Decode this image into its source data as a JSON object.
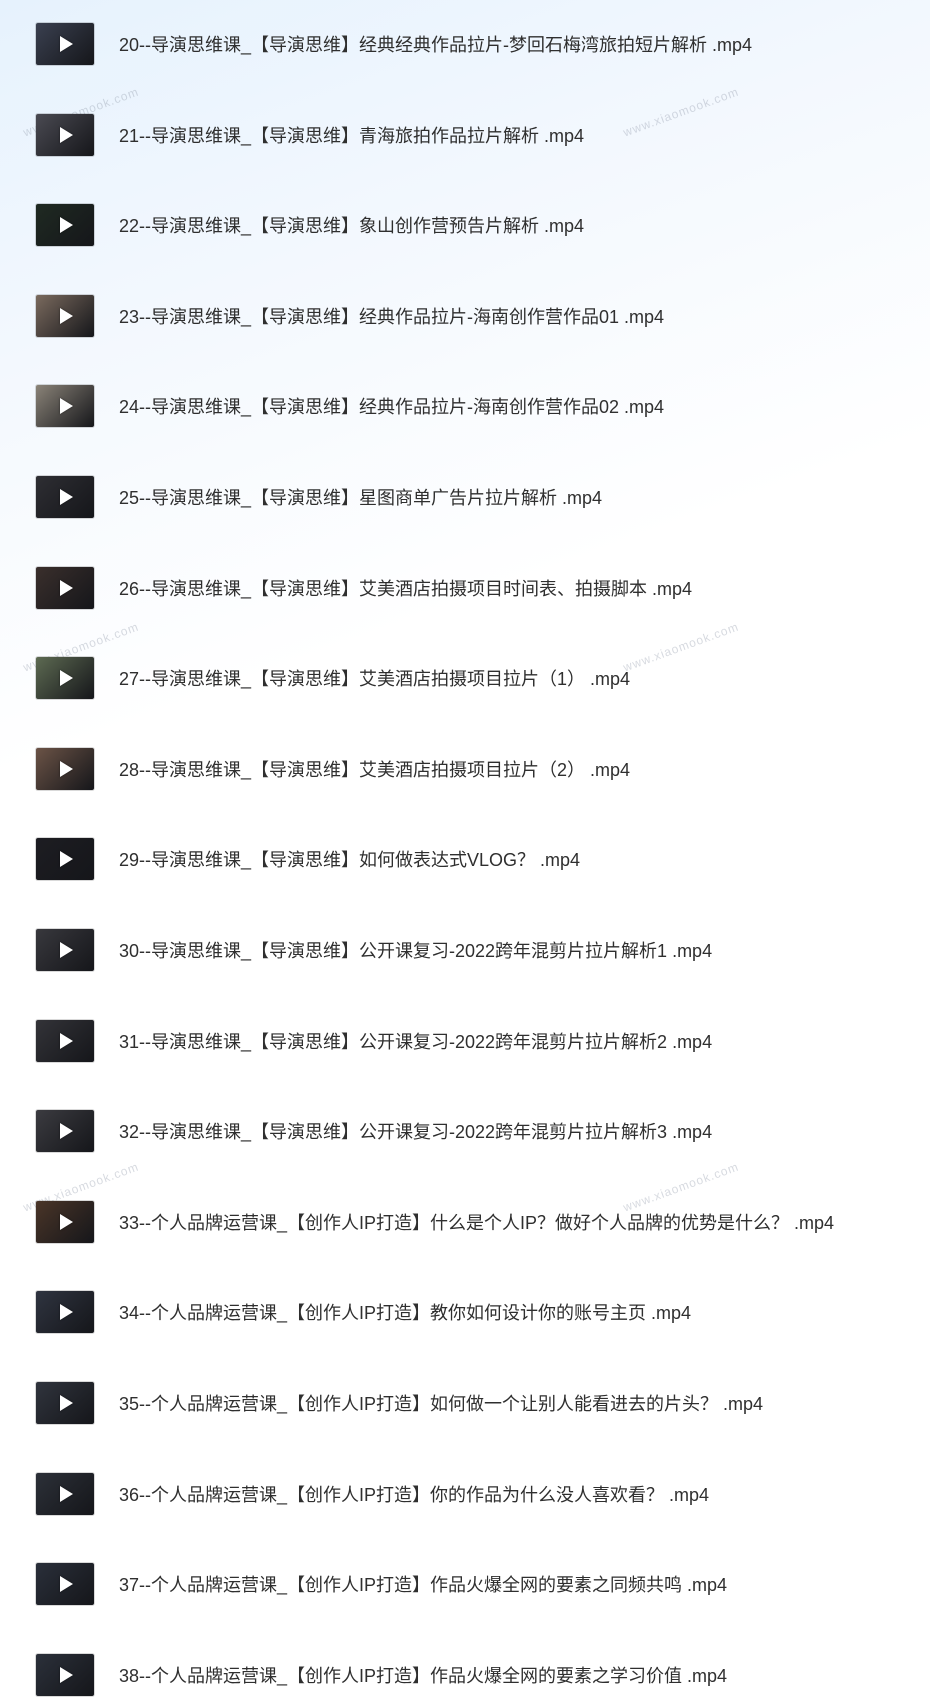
{
  "watermark_text": "www.xiaomook.com",
  "files": [
    {
      "name": "20--导演思维课_【导演思维】经典经典作品拉片-梦回石梅湾旅拍短片解析 .mp4",
      "icon": "video-thumbnail-icon",
      "tone": "#3a4050"
    },
    {
      "name": "21--导演思维课_【导演思维】青海旅拍作品拉片解析 .mp4",
      "icon": "video-thumbnail-icon",
      "tone": "#4a4a52"
    },
    {
      "name": "22--导演思维课_【导演思维】象山创作营预告片解析 .mp4",
      "icon": "video-thumbnail-icon",
      "tone": "#1f2a22"
    },
    {
      "name": "23--导演思维课_【导演思维】经典作品拉片-海南创作营作品01 .mp4",
      "icon": "video-thumbnail-icon",
      "tone": "#7a6a5e"
    },
    {
      "name": "24--导演思维课_【导演思维】经典作品拉片-海南创作营作品02 .mp4",
      "icon": "video-thumbnail-icon",
      "tone": "#8a8378"
    },
    {
      "name": "25--导演思维课_【导演思维】星图商单广告片拉片解析 .mp4",
      "icon": "video-thumbnail-icon",
      "tone": "#2e2e33"
    },
    {
      "name": "26--导演思维课_【导演思维】艾美酒店拍摄项目时间表、拍摄脚本 .mp4",
      "icon": "video-thumbnail-icon",
      "tone": "#3a2f2c"
    },
    {
      "name": "27--导演思维课_【导演思维】艾美酒店拍摄项目拉片（1） .mp4",
      "icon": "video-thumbnail-icon",
      "tone": "#5d6a52"
    },
    {
      "name": "28--导演思维课_【导演思维】艾美酒店拍摄项目拉片（2） .mp4",
      "icon": "video-thumbnail-icon",
      "tone": "#6b5346"
    },
    {
      "name": "29--导演思维课_【导演思维】如何做表达式VLOG？ .mp4",
      "icon": "video-thumbnail-icon",
      "tone": "#1d1d22"
    },
    {
      "name": "30--导演思维课_【导演思维】公开课复习-2022跨年混剪片拉片解析1 .mp4",
      "icon": "video-thumbnail-icon",
      "tone": "#38383d"
    },
    {
      "name": "31--导演思维课_【导演思维】公开课复习-2022跨年混剪片拉片解析2 .mp4",
      "icon": "video-thumbnail-icon",
      "tone": "#333338"
    },
    {
      "name": "32--导演思维课_【导演思维】公开课复习-2022跨年混剪片拉片解析3 .mp4",
      "icon": "video-thumbnail-icon",
      "tone": "#3b3b40"
    },
    {
      "name": "33--个人品牌运营课_【创作人IP打造】什么是个人IP？做好个人品牌的优势是什么？ .mp4",
      "icon": "video-thumbnail-icon",
      "tone": "#4a3528"
    },
    {
      "name": "34--个人品牌运营课_【创作人IP打造】教你如何设计你的账号主页 .mp4",
      "icon": "video-thumbnail-icon",
      "tone": "#2f3440"
    },
    {
      "name": "35--个人品牌运营课_【创作人IP打造】如何做一个让别人能看进去的片头？ .mp4",
      "icon": "video-thumbnail-icon",
      "tone": "#30343d"
    },
    {
      "name": "36--个人品牌运营课_【创作人IP打造】你的作品为什么没人喜欢看？ .mp4",
      "icon": "video-thumbnail-icon",
      "tone": "#2c3038"
    },
    {
      "name": "37--个人品牌运营课_【创作人IP打造】作品火爆全网的要素之同频共鸣 .mp4",
      "icon": "video-thumbnail-icon",
      "tone": "#2a2f3a"
    },
    {
      "name": "38--个人品牌运营课_【创作人IP打造】作品火爆全网的要素之学习价值 .mp4",
      "icon": "video-thumbnail-icon",
      "tone": "#2b303a"
    }
  ]
}
